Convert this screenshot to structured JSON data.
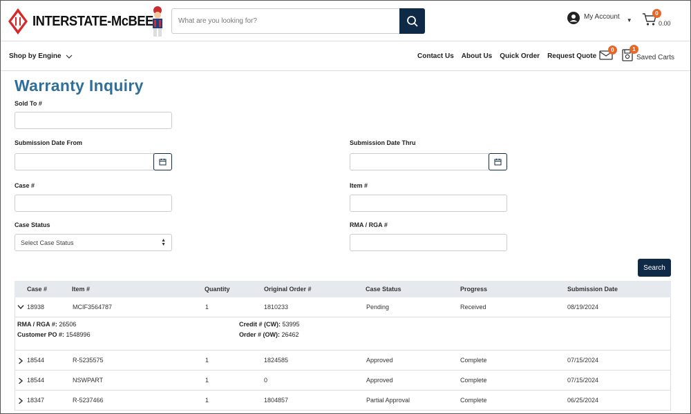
{
  "brand": {
    "name": "INTERSTATE-McBEE",
    "accent": "#e3692a",
    "navy": "#0e2a47",
    "title_blue": "#2f6f9a"
  },
  "header": {
    "search_placeholder": "What are you looking for?",
    "search_icon": "search-icon",
    "account_label": "My Account",
    "cart_badge": "0",
    "cart_total": "0.00"
  },
  "nav": {
    "shop_by_engine": "Shop by Engine",
    "links": [
      "Contact Us",
      "About Us",
      "Quick Order",
      "Request Quote"
    ],
    "mail_badge": "0",
    "saved_badge": "1",
    "saved_carts": "Saved Carts"
  },
  "form": {
    "title": "Warranty Inquiry",
    "sold_to_label": "Sold To #",
    "submission_from_label": "Submission Date From",
    "submission_thru_label": "Submission Date Thru",
    "case_label": "Case #",
    "item_label": "Item #",
    "case_status_label": "Case Status",
    "case_status_value": "Select Case Status",
    "rma_label": "RMA / RGA #",
    "search_button": "Search"
  },
  "table": {
    "columns": [
      "Case #",
      "Item #",
      "Quantity",
      "Original Order #",
      "Case Status",
      "Progress",
      "Submission Date"
    ],
    "rows": [
      {
        "case": "18938",
        "item": "MCIF3564787",
        "qty": "1",
        "order": "1810233",
        "status": "Pending",
        "progress": "Received",
        "date": "08/19/2024",
        "expanded": true
      },
      {
        "case": "18544",
        "item": "R-5235575",
        "qty": "1",
        "order": "1824585",
        "status": "Approved",
        "progress": "Complete",
        "date": "07/15/2024",
        "expanded": false
      },
      {
        "case": "18544",
        "item": "NSWPART",
        "qty": "1",
        "order": "0",
        "status": "Approved",
        "progress": "Complete",
        "date": "07/15/2024",
        "expanded": false
      },
      {
        "case": "18347",
        "item": "R-5237466",
        "qty": "1",
        "order": "1804857",
        "status": "Partial Approval",
        "progress": "Complete",
        "date": "06/25/2024",
        "expanded": false
      }
    ],
    "detail": {
      "rma_label": "RMA / RGA #:",
      "rma_value": "26506",
      "po_label": "Customer PO #:",
      "po_value": "1548996",
      "credit_label": "Credit # (CW):",
      "credit_value": "53995",
      "order_label": "Order # (OW):",
      "order_value": "26462"
    }
  }
}
